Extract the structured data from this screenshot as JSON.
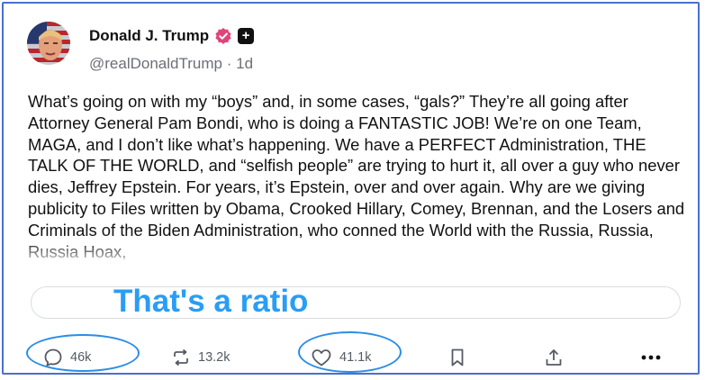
{
  "author": {
    "display_name": "Donald J. Trump",
    "handle": "@realDonaldTrump",
    "separator": "·",
    "age": "1d",
    "plus_badge": "+"
  },
  "post": {
    "text": "What’s going on with my “boys” and, in some cases, “gals?” They’re all going after Attorney General Pam Bondi, who is doing a FANTASTIC JOB! We’re on one Team, MAGA, and I don’t like what’s happening. We have a PERFECT Administration, THE TALK OF THE WORLD, and “selfish people” are trying to hurt it, all over a guy who never dies, Jeffrey Epstein. For years, it’s Epstein, over and over again. Why are we giving publicity to Files written by Obama, Crooked Hillary, Comey, Brennan, and the Losers and Criminals of the Biden Administration, who conned the World with the Russia, Russia, Russia Hoax,"
  },
  "overlay": {
    "annotation_text": "That's a ratio",
    "annotation_color": "#2a9df4"
  },
  "actions": {
    "replies": "46k",
    "reposts": "13.2k",
    "likes": "41.1k"
  },
  "icons": {
    "verified": "verified-badge-icon",
    "reply": "speech-bubble-icon",
    "repost": "repost-arrows-icon",
    "like": "heart-icon",
    "bookmark": "bookmark-icon",
    "share": "share-upload-icon",
    "more": "more-dots-icon"
  }
}
